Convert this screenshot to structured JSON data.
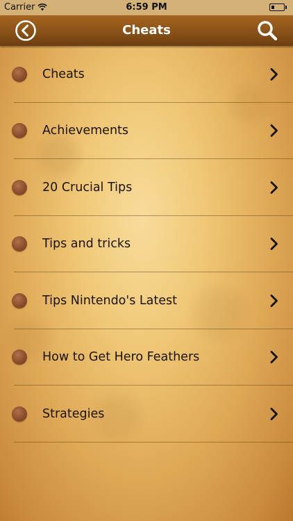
{
  "status_bar": {
    "carrier": "Carrier",
    "wifi_icon": "wifi-icon",
    "time": "6:59 PM",
    "battery_icon": "battery-icon",
    "battery_level": 0.22
  },
  "nav": {
    "title": "Cheats",
    "back_icon": "circled-chevron-left-icon",
    "search_icon": "magnifying-glass-icon"
  },
  "list": {
    "items": [
      {
        "label": "Cheats"
      },
      {
        "label": "Achievements"
      },
      {
        "label": "20 Crucial Tips"
      },
      {
        "label": "Tips and tricks"
      },
      {
        "label": "Tips Nintendo's Latest"
      },
      {
        "label": "How to Get Hero Feathers"
      },
      {
        "label": "Strategies"
      }
    ],
    "bullet_icon": "brown-circle-icon",
    "chevron_icon": "chevron-right-icon"
  },
  "colors": {
    "nav_bar": "#8a5218",
    "status_bar": "#d4b277",
    "paper": "#f0c978",
    "bullet": "#8a4e2c",
    "text": "#1a1108"
  }
}
